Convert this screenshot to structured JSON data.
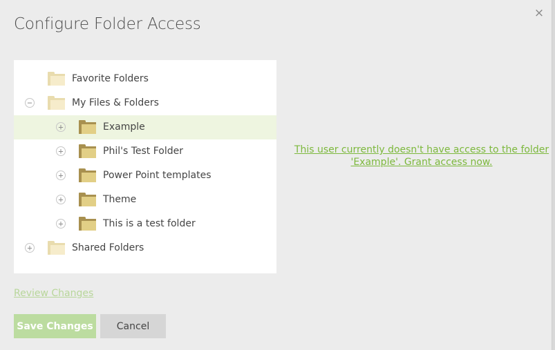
{
  "dialog": {
    "title": "Configure Folder Access",
    "close_glyph": "×"
  },
  "tree": {
    "items": [
      {
        "label": "Favorite Folders",
        "level": 0,
        "expander": "",
        "folder_style": "light",
        "selected": false
      },
      {
        "label": "My Files & Folders",
        "level": 0,
        "expander": "−",
        "folder_style": "light",
        "selected": false
      },
      {
        "label": "Example",
        "level": 1,
        "expander": "+",
        "folder_style": "dark",
        "selected": true
      },
      {
        "label": "Phil's Test Folder",
        "level": 1,
        "expander": "+",
        "folder_style": "dark",
        "selected": false
      },
      {
        "label": "Power Point templates",
        "level": 1,
        "expander": "+",
        "folder_style": "dark",
        "selected": false
      },
      {
        "label": "Theme",
        "level": 1,
        "expander": "+",
        "folder_style": "dark",
        "selected": false
      },
      {
        "label": "This is a test folder",
        "level": 1,
        "expander": "+",
        "folder_style": "dark",
        "selected": false
      },
      {
        "label": "Shared Folders",
        "level": 0,
        "expander": "+",
        "folder_style": "light",
        "selected": false
      }
    ]
  },
  "access_message": {
    "line1": "This user currently doesn't have access to the folder",
    "line2": "'Example'. Grant access now."
  },
  "footer": {
    "review_label": "Review Changes",
    "save_label": "Save Changes",
    "cancel_label": "Cancel"
  },
  "colors": {
    "accent_link": "#7cb83c",
    "save_button": "#bcdca0",
    "selected_row": "#eef5e0"
  },
  "icons": {
    "close": "close-icon",
    "folder": "folder-icon",
    "expand": "plus-circle-icon",
    "collapse": "minus-circle-icon"
  }
}
